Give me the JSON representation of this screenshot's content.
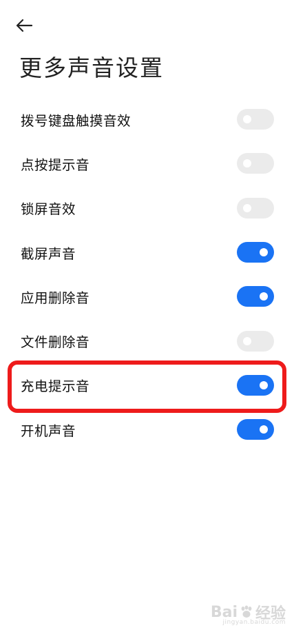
{
  "header": {
    "back_icon": "arrow-left-icon",
    "title": "更多声音设置"
  },
  "settings": [
    {
      "label": "拨号键盘触摸音效",
      "enabled": false
    },
    {
      "label": "点按提示音",
      "enabled": false
    },
    {
      "label": "锁屏音效",
      "enabled": false
    },
    {
      "label": "截屏声音",
      "enabled": true
    },
    {
      "label": "应用删除音",
      "enabled": true
    },
    {
      "label": "文件删除音",
      "enabled": false
    },
    {
      "label": "充电提示音",
      "enabled": true
    },
    {
      "label": "开机声音",
      "enabled": true
    }
  ],
  "colors": {
    "toggle_on": "#1a73f4",
    "toggle_off": "#ebebeb",
    "highlight": "#ee1b1b"
  },
  "watermark": {
    "brand": "Bai",
    "brand_suffix": "经验",
    "url": "jingyan.baidu.com"
  }
}
